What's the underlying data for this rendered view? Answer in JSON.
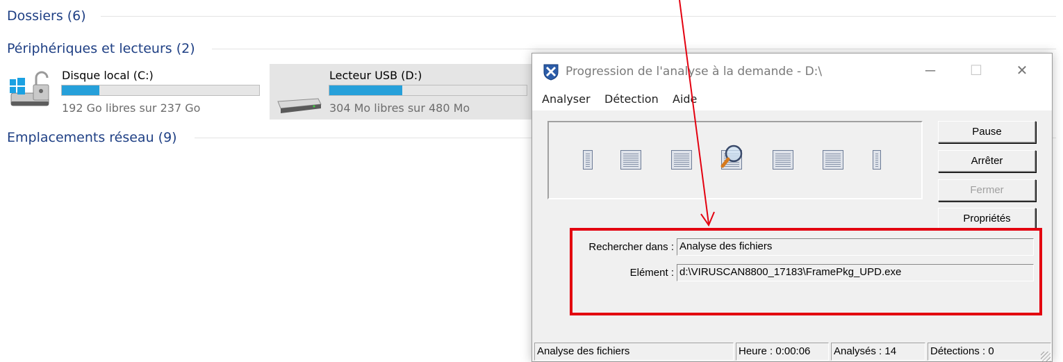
{
  "explorer": {
    "sections": {
      "folders": "Dossiers (6)",
      "devices": "Périphériques et lecteurs (2)",
      "network": "Emplacements réseau (9)"
    },
    "drives": [
      {
        "name": "Disque local (C:)",
        "free_text": "192 Go libres sur 237 Go",
        "used_fraction": 0.19,
        "icon": "windows-drive-icon",
        "selected": false
      },
      {
        "name": "Lecteur USB (D:)",
        "free_text": "304 Mo libres sur 480 Mo",
        "used_fraction": 0.37,
        "icon": "usb-drive-icon",
        "selected": true
      }
    ]
  },
  "dialog": {
    "title": "Progression de l'analyse à la demande - D:\\",
    "title_icon": "mcafee-shield-icon",
    "menu": [
      "Analyser",
      "Détection",
      "Aide"
    ],
    "buttons": {
      "pause": "Pause",
      "stop": "Arrêter",
      "close": "Fermer",
      "properties": "Propriétés"
    },
    "close_disabled": true,
    "fields": {
      "search_in_label": "Rechercher dans :",
      "search_in_value": "Analyse des fichiers",
      "element_label": "Elément :",
      "element_value": "d:\\VIRUSCAN8800_17183\\FramePkg_UPD.exe"
    },
    "status": {
      "activity": "Analyse des fichiers",
      "time": "Heure : 0:00:06",
      "scanned": "Analysés : 14",
      "detections": "Détections : 0"
    }
  },
  "annotation": {
    "highlight_color": "#e3000f",
    "arrow_color": "#e3000f"
  }
}
